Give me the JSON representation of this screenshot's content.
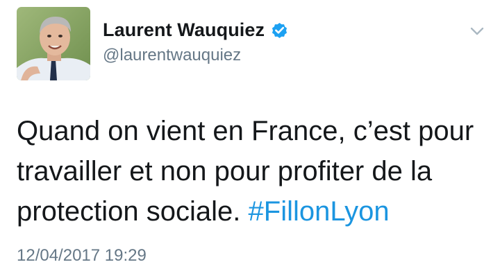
{
  "author": {
    "display_name": "Laurent Wauquiez",
    "handle": "@laurentwauquiez",
    "verified": true,
    "avatar_icon": "profile-photo"
  },
  "tweet": {
    "text_line_1": "Quand on vient en France, c’est pour",
    "text_line_2": "travailler et non pour profiter de la",
    "text_line_3_prefix": "protection sociale.",
    "hashtag": "#FillonLyon",
    "timestamp": "12/04/2017 19:29"
  },
  "menu": {
    "icon": "chevron-down-icon"
  },
  "colors": {
    "text": "#14171a",
    "secondary": "#657786",
    "link": "#1b95e0",
    "verified_badge": "#1da1f2"
  }
}
